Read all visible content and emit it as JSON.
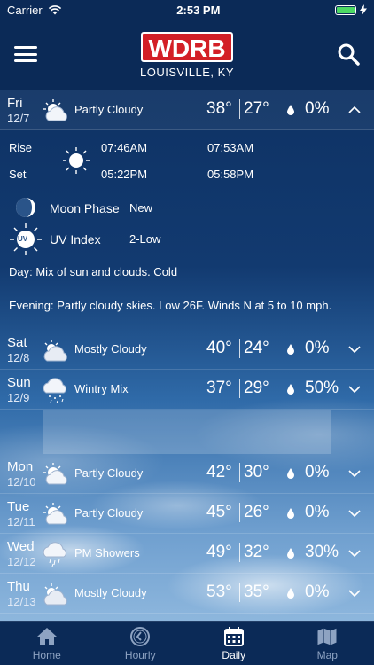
{
  "status": {
    "carrier": "Carrier",
    "time": "2:53 PM"
  },
  "header": {
    "logo": "WDRB",
    "location": "LOUISVILLE, KY"
  },
  "days": [
    {
      "day": "Fri",
      "date": "12/7",
      "condition": "Partly Cloudy",
      "high": "38°",
      "low": "27°",
      "precip": "0%",
      "icon": "partly-cloudy-icon"
    },
    {
      "day": "Sat",
      "date": "12/8",
      "condition": "Mostly Cloudy",
      "high": "40°",
      "low": "24°",
      "precip": "0%",
      "icon": "mostly-cloudy-icon"
    },
    {
      "day": "Sun",
      "date": "12/9",
      "condition": "Wintry Mix",
      "high": "37°",
      "low": "29°",
      "precip": "50%",
      "icon": "wintry-mix-icon"
    },
    {
      "day": "Mon",
      "date": "12/10",
      "condition": "Partly Cloudy",
      "high": "42°",
      "low": "30°",
      "precip": "0%",
      "icon": "partly-cloudy-icon"
    },
    {
      "day": "Tue",
      "date": "12/11",
      "condition": "Partly Cloudy",
      "high": "45°",
      "low": "26°",
      "precip": "0%",
      "icon": "partly-cloudy-icon"
    },
    {
      "day": "Wed",
      "date": "12/12",
      "condition": "PM Showers",
      "high": "49°",
      "low": "32°",
      "precip": "30%",
      "icon": "showers-icon"
    },
    {
      "day": "Thu",
      "date": "12/13",
      "condition": "Mostly Cloudy",
      "high": "53°",
      "low": "35°",
      "precip": "0%",
      "icon": "mostly-cloudy-icon"
    }
  ],
  "details": {
    "rise_label": "Rise",
    "set_label": "Set",
    "sunrise": "07:46AM",
    "sunset": "05:22PM",
    "moonrise": "07:53AM",
    "moonset": "05:58PM",
    "moon_phase_label": "Moon Phase",
    "moon_phase_value": "New",
    "uv_label": "UV Index",
    "uv_value": "2-Low",
    "uv_icon_text": "UV",
    "day_label": "Day",
    "day_text": ": Mix of sun and clouds. Cold",
    "evening_label": "Evening",
    "evening_text": ": Partly cloudy skies. Low 26F. Winds N at 5 to 10 mph."
  },
  "tabs": [
    {
      "label": "Home",
      "icon": "home-icon"
    },
    {
      "label": "Hourly",
      "icon": "clock-icon"
    },
    {
      "label": "Daily",
      "icon": "calendar-icon"
    },
    {
      "label": "Map",
      "icon": "map-icon"
    }
  ],
  "colors": {
    "accent": "#d31f26",
    "header_bg": "#0b2a57",
    "battery": "#4cd964"
  }
}
